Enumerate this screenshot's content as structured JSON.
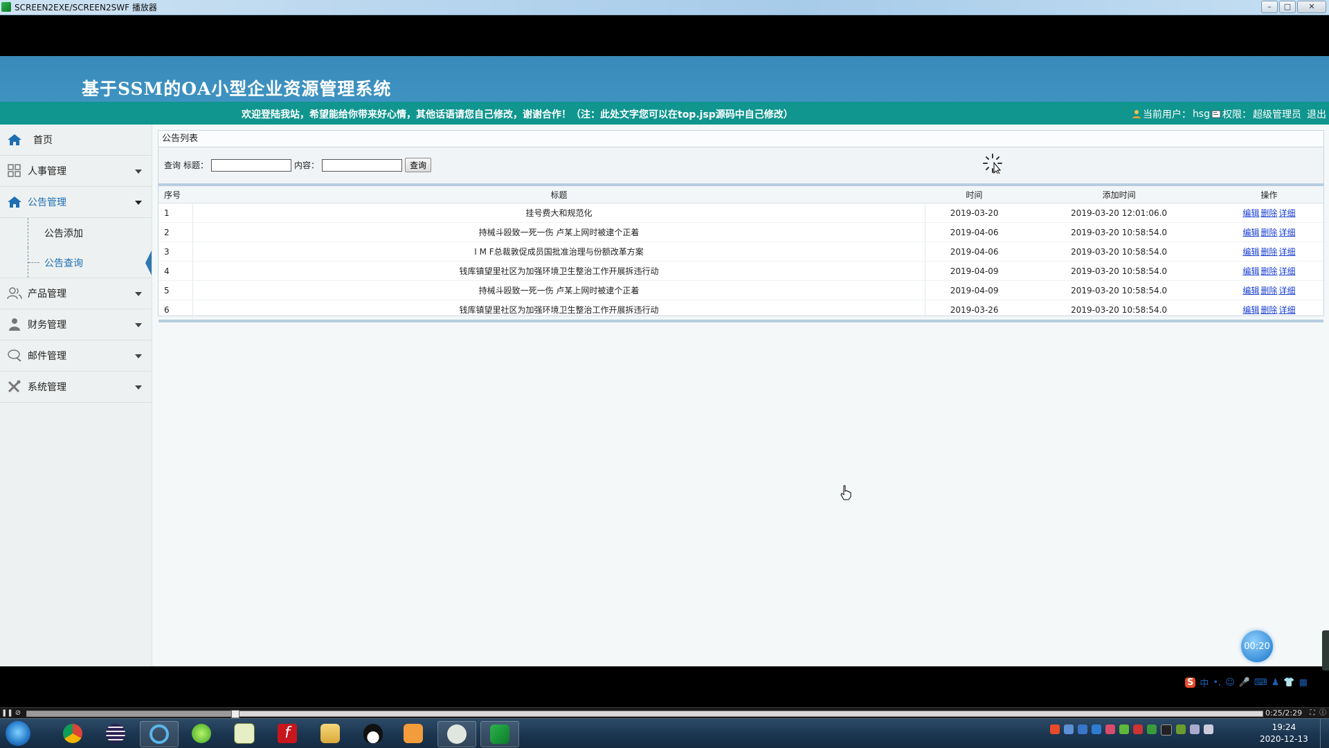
{
  "window": {
    "title": "SCREEN2EXE/SCREEN2SWF 播放器"
  },
  "header": {
    "system_title": "基于SSM的OA小型企业资源管理系统"
  },
  "subbar": {
    "welcome": "欢迎登陆我站，希望能给你带来好心情，其他话语请您自己修改，谢谢合作！（注：此处文字您可以在top.jsp源码中自己修改）",
    "current_user_label": "当前用户：",
    "current_user": "hsg",
    "role_label": "权限：",
    "role": "超级管理员",
    "logout": "退出"
  },
  "sidebar": {
    "home": "首页",
    "items": [
      {
        "label": "人事管理",
        "icon": "grid-icon"
      },
      {
        "label": "公告管理",
        "icon": "home-icon",
        "open": true
      },
      {
        "label": "产品管理",
        "icon": "users-icon"
      },
      {
        "label": "财务管理",
        "icon": "person-icon"
      },
      {
        "label": "邮件管理",
        "icon": "chat-icon"
      },
      {
        "label": "系统管理",
        "icon": "tools-icon"
      }
    ],
    "notice_sub": [
      {
        "label": "公告添加"
      },
      {
        "label": "公告查询",
        "active": true
      }
    ]
  },
  "content": {
    "panel_title": "公告列表",
    "search": {
      "query_label": "查询",
      "title_label": "标题：",
      "content_label": "内容：",
      "title_value": "",
      "content_value": "",
      "button": "查询"
    },
    "table": {
      "headers": [
        "序号",
        "标题",
        "时间",
        "添加时间",
        "操作"
      ],
      "rows": [
        [
          "1",
          "挂号费大和规范化",
          "2019-03-20",
          "2019-03-20 12:01:06.0"
        ],
        [
          "2",
          "持械斗殴致一死一伤 卢某上网时被逮个正着",
          "2019-04-06",
          "2019-03-20 10:58:54.0"
        ],
        [
          "3",
          "I M F总裁敦促成员国批准治理与份额改革方案",
          "2019-04-06",
          "2019-03-20 10:58:54.0"
        ],
        [
          "4",
          "钱库镇望里社区为加强环境卫生整治工作开展拆违行动",
          "2019-04-09",
          "2019-03-20 10:58:54.0"
        ],
        [
          "5",
          "持械斗殴致一死一伤 卢某上网时被逮个正着",
          "2019-04-09",
          "2019-03-20 10:58:54.0"
        ],
        [
          "6",
          "钱库镇望里社区为加强环境卫生整治工作开展拆违行动",
          "2019-03-26",
          "2019-03-20 10:58:54.0"
        ]
      ],
      "ops": [
        "编辑",
        "删除",
        "详细"
      ]
    }
  },
  "overlay": {
    "timer": "00:20"
  },
  "player": {
    "time": "0:25/2:29",
    "progress_fraction": 0.168
  },
  "taskbar": {
    "clock_time": "19:24",
    "clock_date": "2020-12-13"
  },
  "colors": {
    "header_blue": "#3e93c2",
    "subbar_teal": "#10958f",
    "link_blue": "#1a3fd2"
  }
}
